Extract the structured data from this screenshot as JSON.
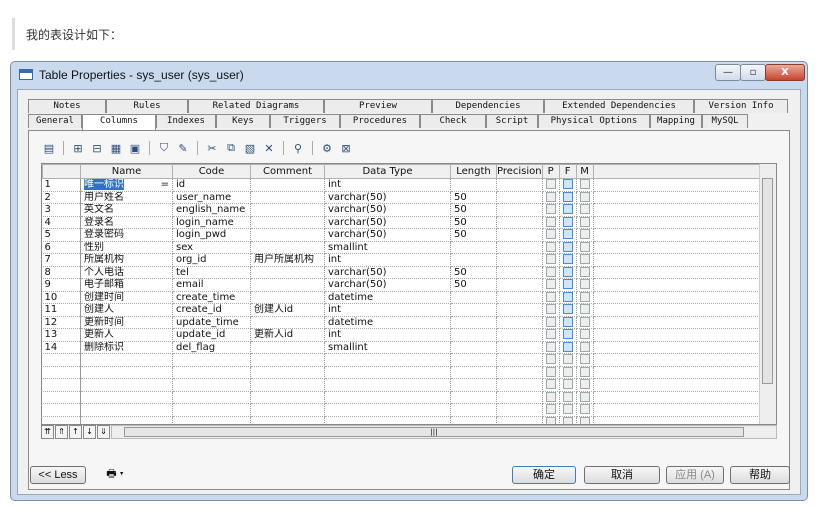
{
  "blog": {
    "text": "我的表设计如下："
  },
  "window": {
    "title": "Table Properties - sys_user (sys_user)",
    "close_label": "X"
  },
  "tabs": {
    "row1": [
      "Notes",
      "Rules",
      "Related Diagrams",
      "Preview",
      "Dependencies",
      "Extended Dependencies",
      "Version Info"
    ],
    "row2": [
      "General",
      "Columns",
      "Indexes",
      "Keys",
      "Triggers",
      "Procedures",
      "Check",
      "Script",
      "Physical Options",
      "Mapping",
      "MySQL"
    ],
    "active": "Columns"
  },
  "toolbar": {
    "icons": [
      "properties-icon",
      "insert-row-icon",
      "add-row-icon",
      "add-columns-icon",
      "delete-row-icon",
      "filter-icon",
      "find-icon",
      "cut-icon",
      "copy-icon",
      "paste-icon",
      "delete-icon",
      "binoculars-icon",
      "customize-columns-icon",
      "excel-export-icon"
    ]
  },
  "grid": {
    "headers": [
      "Name",
      "Code",
      "Comment",
      "Data Type",
      "Length",
      "Precision",
      "P",
      "F",
      "M"
    ],
    "rows": [
      {
        "n": "1",
        "name": "唯一标识",
        "code": "id",
        "comment": "",
        "type": "int",
        "length": "",
        "f": true
      },
      {
        "n": "2",
        "name": "用户姓名",
        "code": "user_name",
        "comment": "",
        "type": "varchar(50)",
        "length": "50",
        "f": true
      },
      {
        "n": "3",
        "name": "英文名",
        "code": "english_name",
        "comment": "",
        "type": "varchar(50)",
        "length": "50",
        "f": true
      },
      {
        "n": "4",
        "name": "登录名",
        "code": "login_name",
        "comment": "",
        "type": "varchar(50)",
        "length": "50",
        "f": true
      },
      {
        "n": "5",
        "name": "登录密码",
        "code": "login_pwd",
        "comment": "",
        "type": "varchar(50)",
        "length": "50",
        "f": true
      },
      {
        "n": "6",
        "name": "性别",
        "code": "sex",
        "comment": "",
        "type": "smallint",
        "length": "",
        "f": true
      },
      {
        "n": "7",
        "name": "所属机构",
        "code": "org_id",
        "comment": "用户所属机构",
        "type": "int",
        "length": "",
        "f": true
      },
      {
        "n": "8",
        "name": "个人电话",
        "code": "tel",
        "comment": "",
        "type": "varchar(50)",
        "length": "50",
        "f": true
      },
      {
        "n": "9",
        "name": "电子邮箱",
        "code": "email",
        "comment": "",
        "type": "varchar(50)",
        "length": "50",
        "f": true
      },
      {
        "n": "10",
        "name": "创建时间",
        "code": "create_time",
        "comment": "",
        "type": "datetime",
        "length": "",
        "f": true
      },
      {
        "n": "11",
        "name": "创建人",
        "code": "create_id",
        "comment": "创建人id",
        "type": "int",
        "length": "",
        "f": true
      },
      {
        "n": "12",
        "name": "更新时间",
        "code": "update_time",
        "comment": "",
        "type": "datetime",
        "length": "",
        "f": true
      },
      {
        "n": "13",
        "name": "更新人",
        "code": "update_id",
        "comment": "更新人id",
        "type": "int",
        "length": "",
        "f": true
      },
      {
        "n": "14",
        "name": "删除标识",
        "code": "del_flag",
        "comment": "",
        "type": "smallint",
        "length": "",
        "f": true
      }
    ],
    "selected_marker": "="
  },
  "footer": {
    "less": "<< Less",
    "ok": "确定",
    "cancel": "取消",
    "apply": "应用 (A)",
    "help": "帮助"
  }
}
